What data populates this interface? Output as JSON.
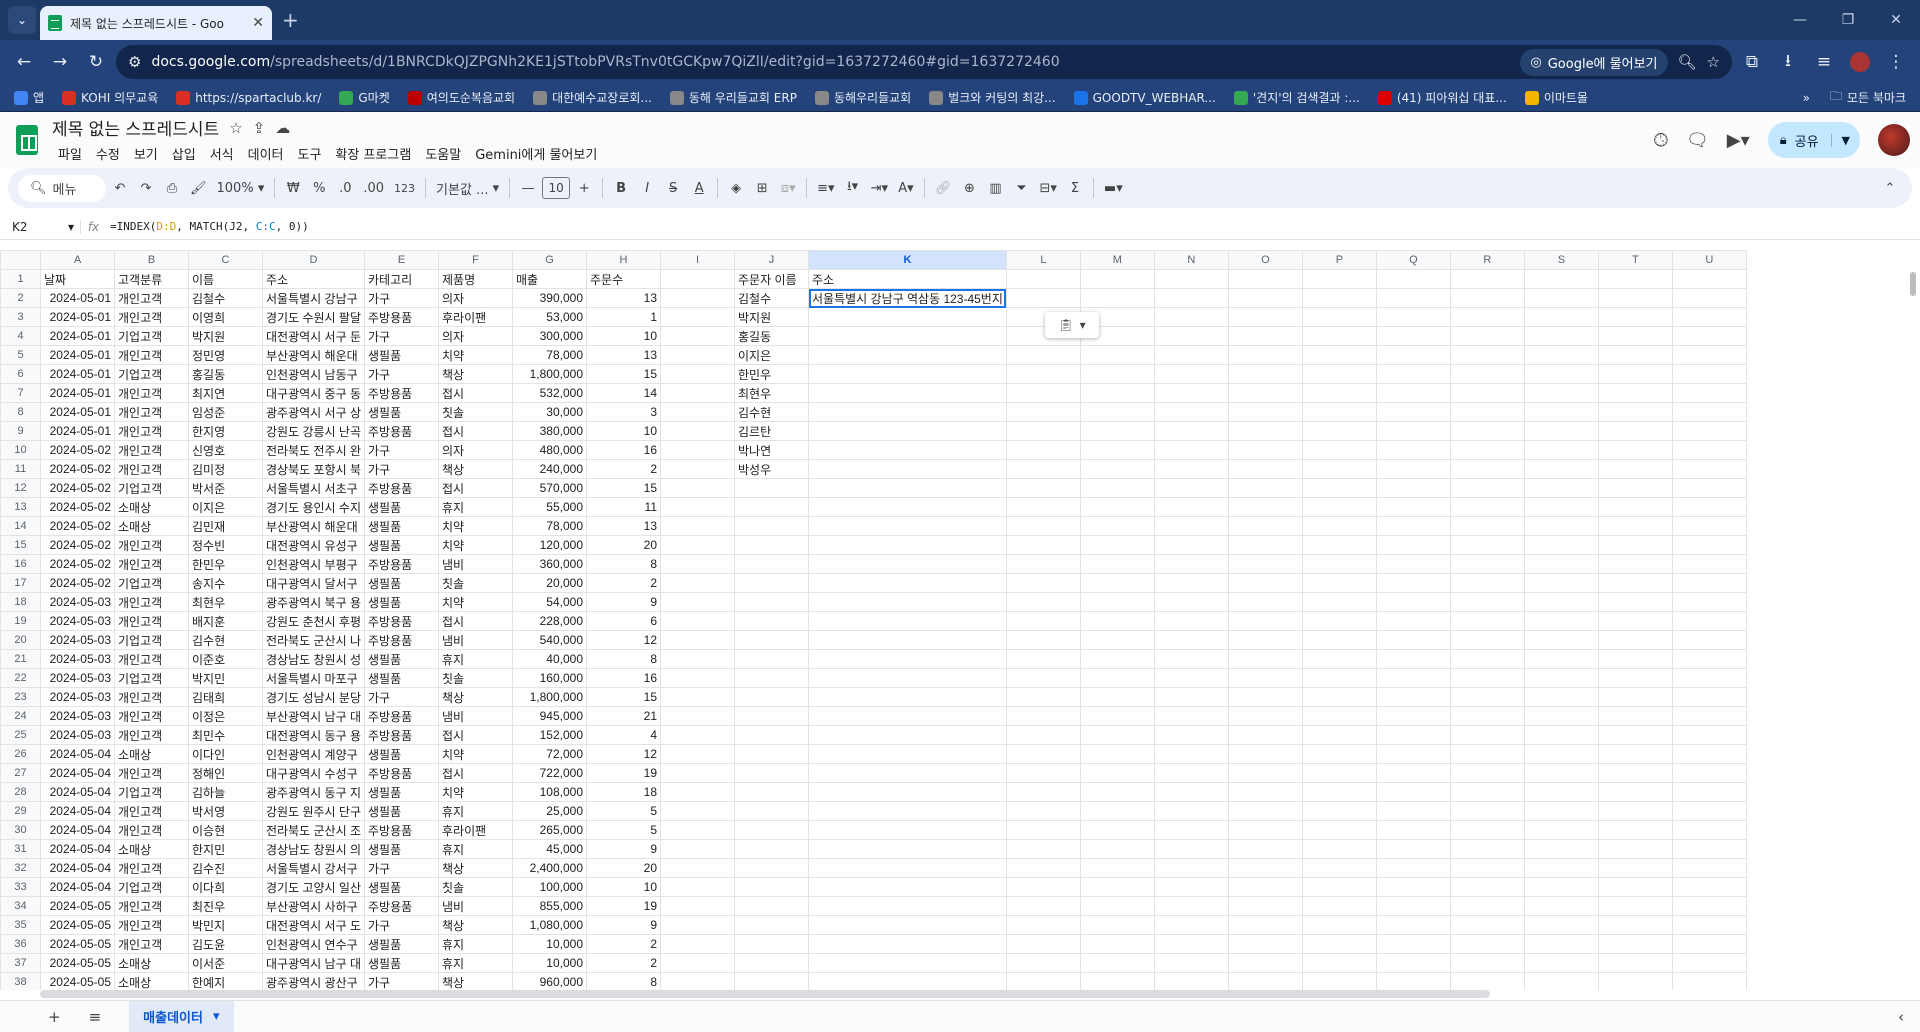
{
  "browser": {
    "tab_title": "제목 없는 스프레드시트 - Goo",
    "url_host": "docs.google.com",
    "url_path": "/spreadsheets/d/1BNRCDkQJZPGNh2KE1jSTtobPVRsTnv0tGCKpw7QiZlI/edit?gid=1637272460#gid=1637272460",
    "ask_google": "Google에 물어보기",
    "bookmarks": [
      "앱",
      "KOHI 의무교육",
      "https://spartaclub.kr/",
      "G마켓",
      "여의도순복음교회",
      "대한예수교장로회...",
      "동해 우리들교회 ERP",
      "동해우리들교회",
      "벌크와 커팅의 최강...",
      "GOODTV_WEBHAR...",
      "'견지'의 검색결과 :...",
      "(41) 피아워십 대표...",
      "이마트몰"
    ],
    "all_bookmarks": "모든 북마크"
  },
  "doc": {
    "title": "제목 없는 스프레드시트",
    "menus": [
      "파일",
      "수정",
      "보기",
      "삽입",
      "서식",
      "데이터",
      "도구",
      "확장 프로그램",
      "도움말",
      "Gemini에게 물어보기"
    ],
    "share": "공유"
  },
  "toolbar": {
    "menu_search": "메뉴",
    "zoom": "100%",
    "currency": "₩",
    "percent": "%",
    "dec_less": ".0",
    "dec_more": ".00",
    "num123": "123",
    "font": "기본값 ...",
    "font_size": "10"
  },
  "formula_bar": {
    "cell": "K2",
    "formula_pre": "=INDEX(",
    "r1": "D:D",
    "mid": ", MATCH(J2, ",
    "r2": "C:C",
    "post": ", 0))"
  },
  "columns": [
    "A",
    "B",
    "C",
    "D",
    "E",
    "F",
    "G",
    "H",
    "I",
    "J",
    "K",
    "L",
    "M",
    "N",
    "O",
    "P",
    "Q",
    "R",
    "S",
    "T",
    "U"
  ],
  "header_row": [
    "날짜",
    "고객분류",
    "이름",
    "주소",
    "카테고리",
    "제품명",
    "매출",
    "주문수",
    "",
    "주문자 이름",
    "주소"
  ],
  "rows": [
    [
      "2024-05-01",
      "개인고객",
      "김철수",
      "서울특별시 강남구",
      "가구",
      "의자",
      "390,000",
      "13"
    ],
    [
      "2024-05-01",
      "개인고객",
      "이영희",
      "경기도 수원시 팔달",
      "주방용품",
      "후라이팬",
      "53,000",
      "1"
    ],
    [
      "2024-05-01",
      "기업고객",
      "박지원",
      "대전광역시 서구 둔",
      "가구",
      "의자",
      "300,000",
      "10"
    ],
    [
      "2024-05-01",
      "개인고객",
      "정민영",
      "부산광역시 해운대",
      "생필품",
      "치약",
      "78,000",
      "13"
    ],
    [
      "2024-05-01",
      "기업고객",
      "홍길동",
      "인천광역시 남동구",
      "가구",
      "책상",
      "1,800,000",
      "15"
    ],
    [
      "2024-05-01",
      "개인고객",
      "최지연",
      "대구광역시 중구 동",
      "주방용품",
      "접시",
      "532,000",
      "14"
    ],
    [
      "2024-05-01",
      "개인고객",
      "임성준",
      "광주광역시 서구 상",
      "생필품",
      "칫솔",
      "30,000",
      "3"
    ],
    [
      "2024-05-01",
      "개인고객",
      "한지영",
      "강원도 강릉시 난곡",
      "주방용품",
      "접시",
      "380,000",
      "10"
    ],
    [
      "2024-05-02",
      "개인고객",
      "신영호",
      "전라북도 전주시 완",
      "가구",
      "의자",
      "480,000",
      "16"
    ],
    [
      "2024-05-02",
      "개인고객",
      "김미정",
      "경상북도 포항시 북",
      "가구",
      "책상",
      "240,000",
      "2"
    ],
    [
      "2024-05-02",
      "기업고객",
      "박서준",
      "서울특별시 서초구",
      "주방용품",
      "접시",
      "570,000",
      "15"
    ],
    [
      "2024-05-02",
      "소매상",
      "이지은",
      "경기도 용인시 수지",
      "생필품",
      "휴지",
      "55,000",
      "11"
    ],
    [
      "2024-05-02",
      "소매상",
      "김민재",
      "부산광역시 해운대",
      "생필품",
      "치약",
      "78,000",
      "13"
    ],
    [
      "2024-05-02",
      "개인고객",
      "정수빈",
      "대전광역시 유성구",
      "생필품",
      "치약",
      "120,000",
      "20"
    ],
    [
      "2024-05-02",
      "개인고객",
      "한민우",
      "인천광역시 부평구",
      "주방용품",
      "냄비",
      "360,000",
      "8"
    ],
    [
      "2024-05-02",
      "기업고객",
      "송지수",
      "대구광역시 달서구",
      "생필품",
      "칫솔",
      "20,000",
      "2"
    ],
    [
      "2024-05-03",
      "개인고객",
      "최현우",
      "광주광역시 북구 용",
      "생필품",
      "치약",
      "54,000",
      "9"
    ],
    [
      "2024-05-03",
      "개인고객",
      "배지훈",
      "강원도 춘천시 후평",
      "주방용품",
      "접시",
      "228,000",
      "6"
    ],
    [
      "2024-05-03",
      "기업고객",
      "김수현",
      "전라북도 군산시 나",
      "주방용품",
      "냄비",
      "540,000",
      "12"
    ],
    [
      "2024-05-03",
      "개인고객",
      "이준호",
      "경상남도 창원시 성",
      "생필품",
      "휴지",
      "40,000",
      "8"
    ],
    [
      "2024-05-03",
      "기업고객",
      "박지민",
      "서울특별시 마포구",
      "생필품",
      "칫솔",
      "160,000",
      "16"
    ],
    [
      "2024-05-03",
      "개인고객",
      "김태희",
      "경기도 성남시 분당",
      "가구",
      "책상",
      "1,800,000",
      "15"
    ],
    [
      "2024-05-03",
      "개인고객",
      "이정은",
      "부산광역시 남구 대",
      "주방용품",
      "냄비",
      "945,000",
      "21"
    ],
    [
      "2024-05-03",
      "개인고객",
      "최민수",
      "대전광역시 동구 용",
      "주방용품",
      "접시",
      "152,000",
      "4"
    ],
    [
      "2024-05-04",
      "소매상",
      "이다인",
      "인천광역시 계양구",
      "생필품",
      "치약",
      "72,000",
      "12"
    ],
    [
      "2024-05-04",
      "개인고객",
      "정해인",
      "대구광역시 수성구",
      "주방용품",
      "접시",
      "722,000",
      "19"
    ],
    [
      "2024-05-04",
      "기업고객",
      "김하늘",
      "광주광역시 동구 지",
      "생필품",
      "치약",
      "108,000",
      "18"
    ],
    [
      "2024-05-04",
      "개인고객",
      "박서영",
      "강원도 원주시 단구",
      "생필품",
      "휴지",
      "25,000",
      "5"
    ],
    [
      "2024-05-04",
      "개인고객",
      "이승현",
      "전라북도 군산시 조",
      "주방용품",
      "후라이팬",
      "265,000",
      "5"
    ],
    [
      "2024-05-04",
      "소매상",
      "한지민",
      "경상남도 창원시 의",
      "생필품",
      "휴지",
      "45,000",
      "9"
    ],
    [
      "2024-05-04",
      "개인고객",
      "김수진",
      "서울특별시 강서구",
      "가구",
      "책상",
      "2,400,000",
      "20"
    ],
    [
      "2024-05-04",
      "기업고객",
      "이다희",
      "경기도 고양시 일산",
      "생필품",
      "칫솔",
      "100,000",
      "10"
    ],
    [
      "2024-05-05",
      "개인고객",
      "최진우",
      "부산광역시 사하구",
      "주방용품",
      "냄비",
      "855,000",
      "19"
    ],
    [
      "2024-05-05",
      "개인고객",
      "박민지",
      "대전광역시 서구 도",
      "가구",
      "책상",
      "1,080,000",
      "9"
    ],
    [
      "2024-05-05",
      "개인고객",
      "김도윤",
      "인천광역시 연수구",
      "생필품",
      "휴지",
      "10,000",
      "2"
    ],
    [
      "2024-05-05",
      "소매상",
      "이서준",
      "대구광역시 남구 대",
      "생필품",
      "휴지",
      "10,000",
      "2"
    ],
    [
      "2024-05-05",
      "소매상",
      "한예지",
      "광주광역시 광산구",
      "가구",
      "책상",
      "960,000",
      "8"
    ]
  ],
  "j_names": [
    "김철수",
    "박지원",
    "홍길동",
    "이지은",
    "한민우",
    "최현우",
    "김수현",
    "김르탄",
    "박나연",
    "박성우"
  ],
  "k2_value": "서울특별시 강남구 역삼동 123-45번지",
  "sheet_tab": "매출데이터"
}
